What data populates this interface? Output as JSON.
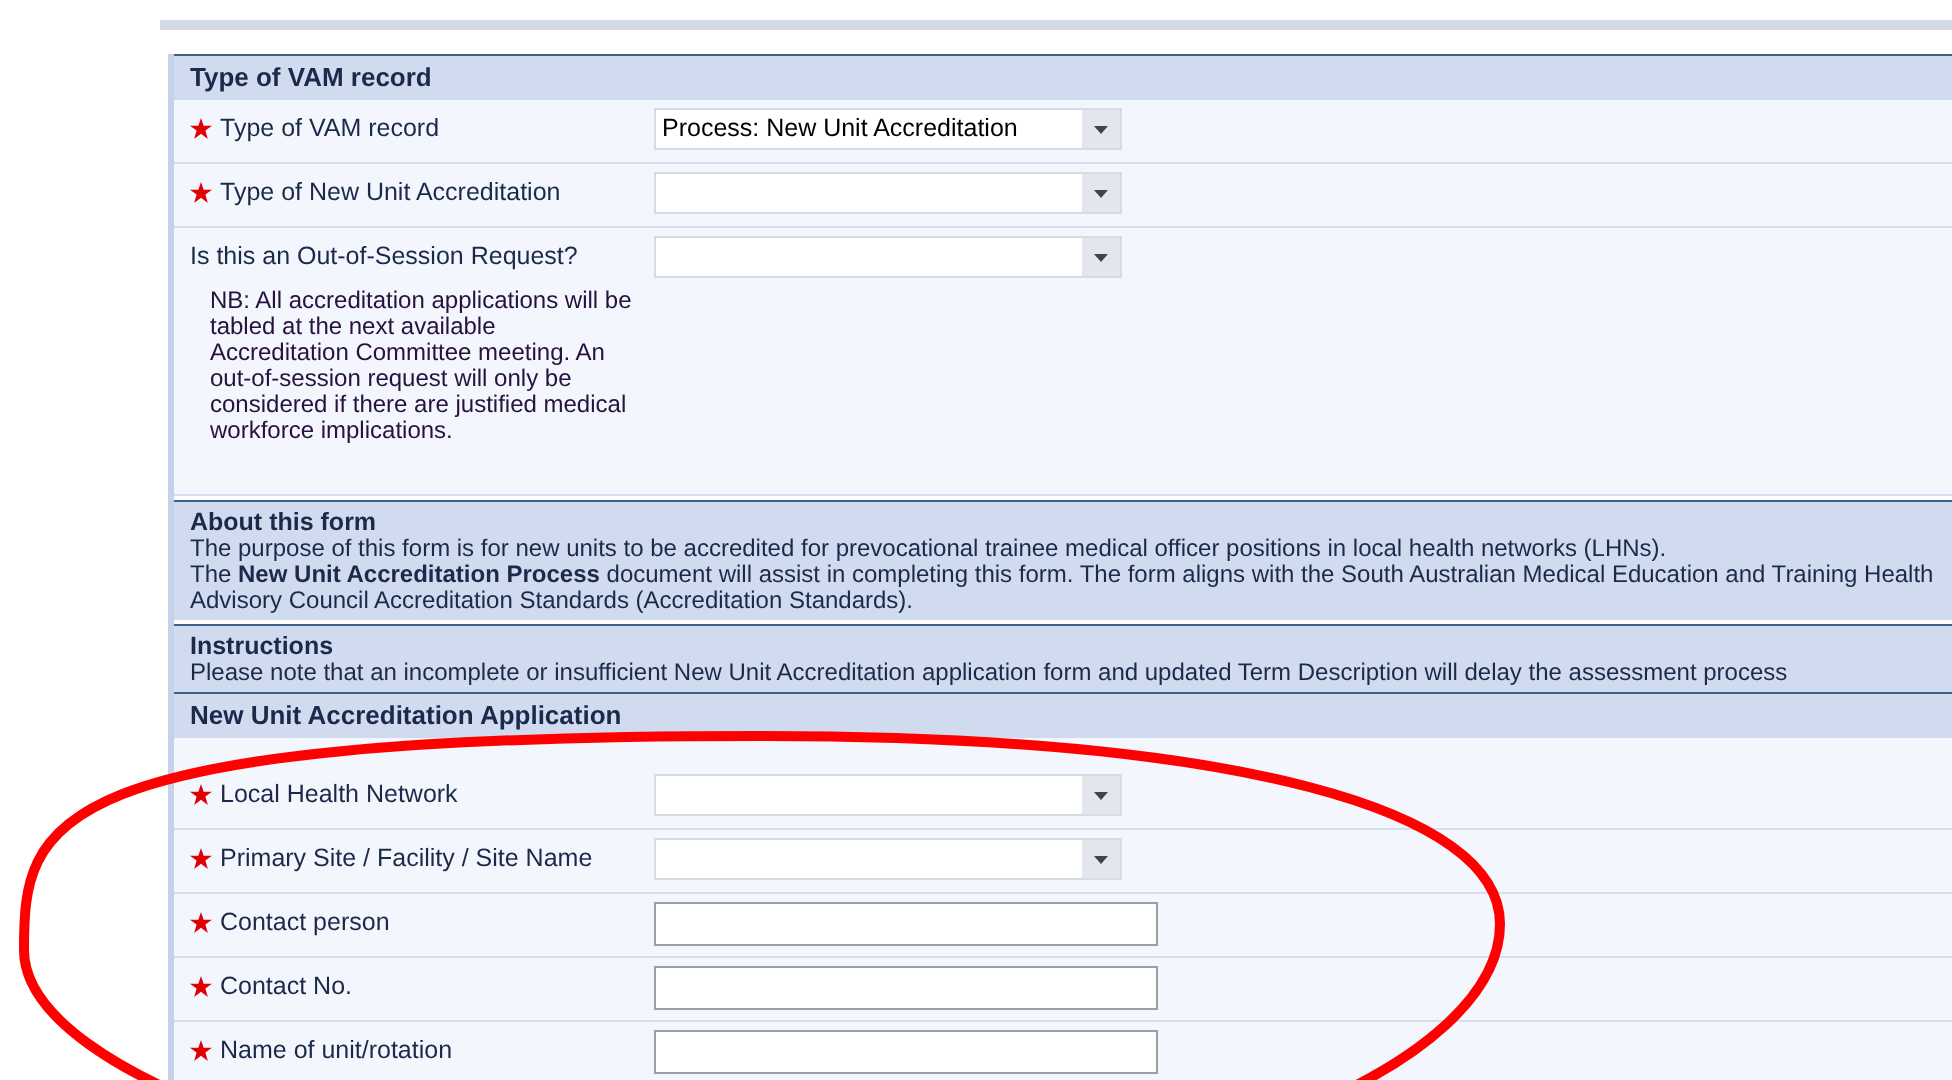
{
  "sections": [
    {
      "kind": "form",
      "title": "Type of VAM record",
      "fields": [
        {
          "label": "Type of VAM record",
          "required": true,
          "kind": "select",
          "value": "Process: New Unit Accreditation"
        },
        {
          "label": "Type of New Unit Accreditation",
          "required": true,
          "kind": "select"
        },
        {
          "label": "Is this an Out-of-Session Request?",
          "required": false,
          "kind": "select",
          "note": "NB: All accreditation applications will be tabled at the next available Accreditation Committee meeting. An out-of-session request will only be considered if there are justified medical workforce implications."
        }
      ]
    },
    {
      "kind": "info",
      "title": "About this form",
      "paragraphs": [
        "The purpose of this form is for new units to be accredited for prevocational trainee medical officer positions in local health networks (LHNs).",
        "The **New Unit Accreditation Process** document will assist in completing this form. The form aligns with the South Australian Medical Education and Training Health Advisory Council Accreditation Standards (Accreditation Standards)."
      ]
    },
    {
      "kind": "info",
      "title": "Instructions",
      "paragraphs": [
        "Please note that an incomplete or insufficient New Unit Accreditation application form and updated Term Description will delay the assessment process"
      ]
    },
    {
      "kind": "form",
      "title": "New Unit Accreditation Application",
      "fields": [
        {
          "label": "Local Health Network",
          "required": true,
          "kind": "select"
        },
        {
          "label": "Primary Site / Facility / Site Name",
          "required": true,
          "kind": "select"
        },
        {
          "label": "Contact person",
          "required": true,
          "kind": "text"
        },
        {
          "label": "Contact No.",
          "required": true,
          "kind": "text"
        },
        {
          "label": "Name of unit/rotation",
          "required": true,
          "kind": "text"
        }
      ]
    }
  ],
  "annotation": {
    "kind": "ellipse",
    "color": "#ff0000"
  }
}
